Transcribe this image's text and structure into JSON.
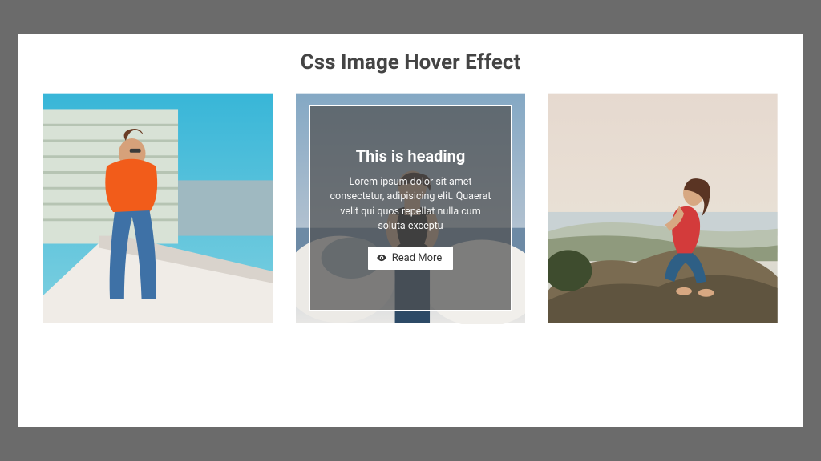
{
  "page": {
    "title": "Css Image Hover Effect"
  },
  "cards": [
    {
      "alt": "woman-orange-tshirt-rooftop"
    },
    {
      "alt": "woman-black-top-santorini"
    },
    {
      "alt": "woman-red-top-rocks-sea"
    }
  ],
  "overlay": {
    "heading": "This is heading",
    "text": "Lorem ipsum dolor sit amet consectetur, adipisicing elit. Quaerat velit qui quos repellat nulla cum soluta exceptu",
    "button_label": "Read More"
  }
}
